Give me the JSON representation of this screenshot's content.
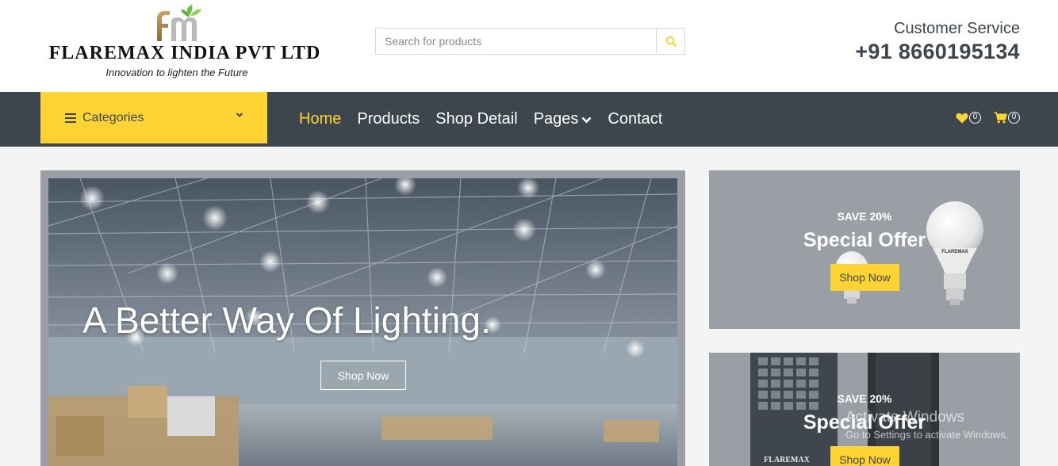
{
  "brand": {
    "logo_letters": "fm",
    "name": "FLAREMAX INDIA PVT LTD",
    "tagline": "Innovation to lighten the Future"
  },
  "search": {
    "placeholder": "Search for products",
    "icon": "search-icon"
  },
  "customer_service": {
    "label": "Customer Service",
    "phone": "+91 8660195134"
  },
  "nav": {
    "categories_label": "Categories",
    "items": [
      {
        "label": "Home",
        "active": true
      },
      {
        "label": "Products",
        "active": false
      },
      {
        "label": "Shop Detail",
        "active": false
      },
      {
        "label": "Pages",
        "active": false,
        "has_dropdown": true
      },
      {
        "label": "Contact",
        "active": false
      }
    ],
    "wishlist_count": "0",
    "cart_count": "0"
  },
  "hero": {
    "title": "A Better Way Of Lighting.",
    "button_label": "Shop Now"
  },
  "offers": [
    {
      "kicker": "SAVE 20%",
      "title": "Special Offer",
      "button_label": "Shop Now",
      "product_label": "FLAREMAX"
    },
    {
      "kicker": "SAVE 20%",
      "title": "Special Offer",
      "button_label": "Shop Now",
      "product_label": "FLAREMAX"
    }
  ],
  "windows_watermark": {
    "line1": "Activate Windows",
    "line2": "Go to Settings to activate Windows."
  },
  "colors": {
    "accent": "#ffd333",
    "nav_bg": "#3d464d",
    "page_bg": "#f4f4f4"
  }
}
